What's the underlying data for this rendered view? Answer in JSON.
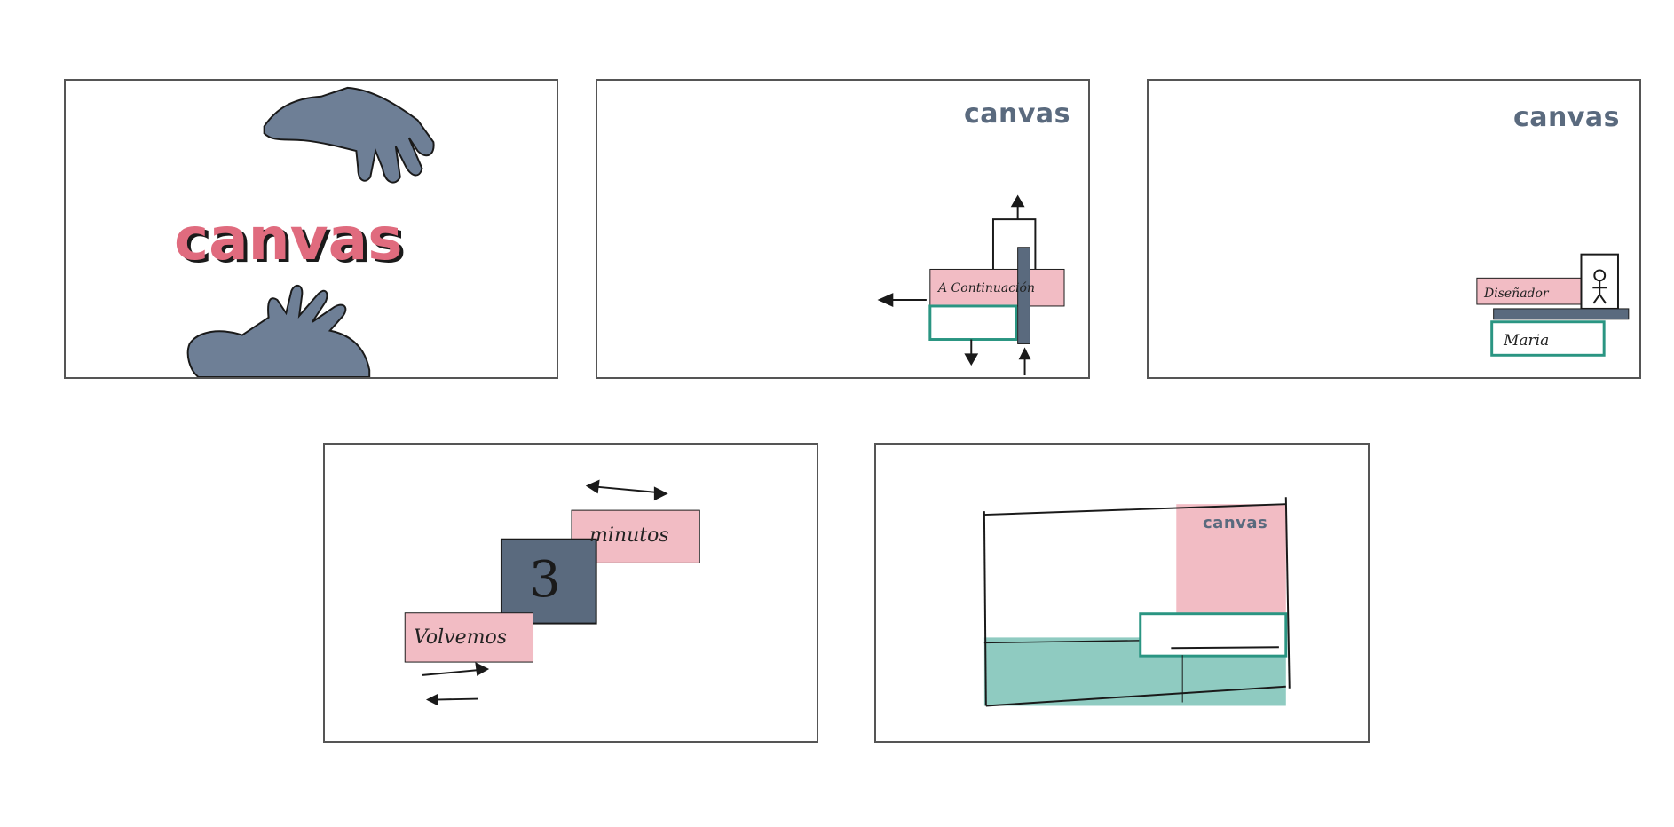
{
  "colors": {
    "slate": "#5a6a7e",
    "pink": "#f2bcc4",
    "pink_strong": "#e06b7e",
    "teal": "#2a9582",
    "teal_fill": "#8fcbc1",
    "ink": "#1a1a1a"
  },
  "panels": [
    {
      "id": "panel-1",
      "logo": "canvas",
      "icons": [
        "top-hand-icon",
        "bottom-hand-icon"
      ]
    },
    {
      "id": "panel-2",
      "logo": "canvas",
      "lower_third": "A Continuación",
      "icons": [
        "arrow-left-icon",
        "arrow-up-icon",
        "arrow-down-icon",
        "arrow-up-small-icon"
      ]
    },
    {
      "id": "panel-3",
      "logo": "canvas",
      "role": "Diseñador",
      "name": "Maria",
      "icons": [
        "stick-figure-icon"
      ]
    },
    {
      "id": "panel-4",
      "left_label": "Volvemos",
      "number": "3",
      "right_label": "minutos",
      "icons": [
        "double-arrow-icon",
        "arrow-right-icon",
        "arrow-left-icon"
      ]
    },
    {
      "id": "panel-5",
      "logo": "canvas"
    }
  ]
}
